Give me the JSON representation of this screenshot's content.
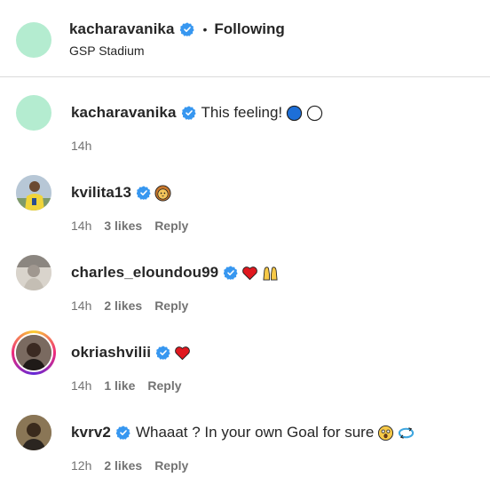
{
  "post_header": {
    "username": "kacharavanika",
    "verified": true,
    "separator": "•",
    "follow_status": "Following",
    "location": "GSP Stadium"
  },
  "comments": [
    {
      "username": "kacharavanika",
      "verified": true,
      "text": "This feeling!",
      "emojis": [
        "blue-circle-emoji",
        "white-circle-emoji"
      ],
      "time": "14h",
      "likes": "",
      "reply": ""
    },
    {
      "username": "kvilita13",
      "verified": true,
      "text": "",
      "emojis": [
        "lion-face-emoji"
      ],
      "time": "14h",
      "likes": "3 likes",
      "reply": "Reply"
    },
    {
      "username": "charles_eloundou99",
      "verified": true,
      "text": "",
      "emojis": [
        "red-heart-emoji",
        "raising-hands-emoji"
      ],
      "time": "14h",
      "likes": "2 likes",
      "reply": "Reply"
    },
    {
      "username": "okriashvilii",
      "verified": true,
      "text": "",
      "emojis": [
        "red-heart-emoji"
      ],
      "time": "14h",
      "likes": "1 like",
      "reply": "Reply"
    },
    {
      "username": "kvrv2",
      "verified": true,
      "text": "Whaaat ? In your own Goal for sure",
      "emojis": [
        "astonished-face-emoji",
        "repeat-arrows-emoji"
      ],
      "time": "12h",
      "likes": "2 likes",
      "reply": "Reply"
    }
  ],
  "colors": {
    "verified_blue": "#3797f0",
    "secondary_text": "#737373",
    "divider": "#dbdbdb",
    "mint_avatar": "#b4ecd0"
  }
}
